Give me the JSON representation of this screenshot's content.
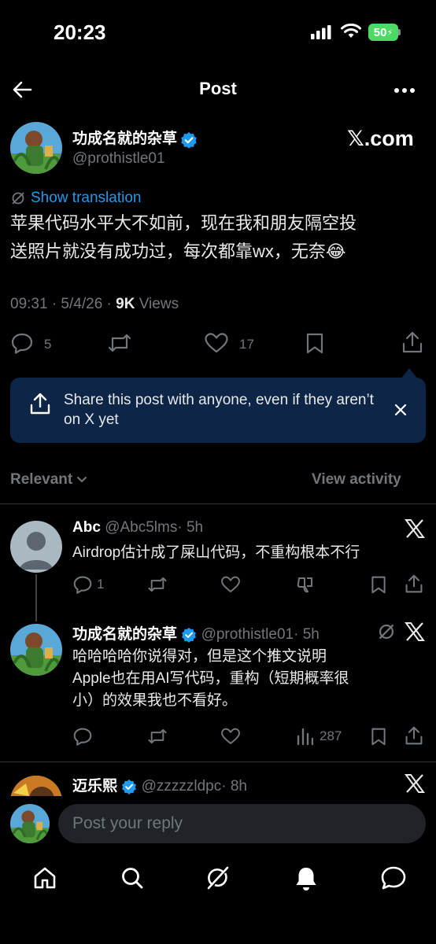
{
  "status_bar": {
    "time": "20:23",
    "battery": "50"
  },
  "header": {
    "title": "Post"
  },
  "post": {
    "author_name": "功成名就的杂草",
    "author_handle": "@prothistle01",
    "source_badge": "𝕏.com",
    "show_translation": "Show translation",
    "text_line1": "苹果代码水平大不如前，现在我和朋友隔空投",
    "text_line2": "送照片就没有成功过，每次都靠wx，无奈😂",
    "time": "09:31 · 5/4/26 · ",
    "views_count": "9K",
    "views_label": " Views",
    "replies": "5",
    "likes": "17"
  },
  "share_banner": {
    "text": "Share this post with anyone, even if they aren’t on X yet"
  },
  "replies_bar": {
    "sort_label": "Relevant",
    "view_activity": "View activity"
  },
  "replies": [
    {
      "name": "Abc",
      "handle": "@Abc5lms",
      "time": "· 5h",
      "text": "Airdrop估计成了屎山代码，不重构根本不行",
      "reply_count": "1"
    },
    {
      "name": "功成名就的杂草",
      "handle": "@prothistle01",
      "time": "· 5h",
      "text_line1": "哈哈哈哈你说得对，但是这个推文说明",
      "text_line2": "Apple也在用AI写代码，重构（短期概率很",
      "text_line3": "小）的效果我也不看好。",
      "views": "287"
    },
    {
      "name": "迈乐熙",
      "handle": "@zzzzzldpc",
      "time": "· 8h"
    }
  ],
  "composer": {
    "placeholder": "Post your reply"
  },
  "colors": {
    "accent": "#1d9bf0",
    "share_bg": "#0d2546",
    "muted": "#71767b"
  }
}
